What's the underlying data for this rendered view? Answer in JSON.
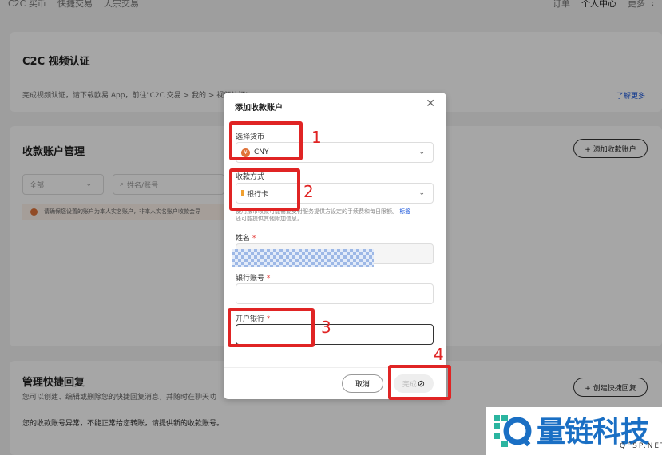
{
  "topnav": {
    "items": [
      "C2C 买币",
      "快捷交易",
      "大宗交易"
    ],
    "right": [
      "订单",
      "个人中心",
      "更多"
    ]
  },
  "video_section": {
    "title": "C2C 视频认证",
    "desc": "完成视频认证，请下载欧易 App，前往\"C2C 交易 > 我的 > 视频认证\"",
    "link": "了解更多"
  },
  "accounts_section": {
    "title": "收款账户管理",
    "add_button": "+ 添加收款账户",
    "filter_value": "全部",
    "search_placeholder": "姓名/账号",
    "notice": "请确保您设置的账户为本人实名账户，非本人实名账户收款会导"
  },
  "quick_reply_section": {
    "title": "管理快捷回复",
    "desc": "您可以创建、编辑或删除您的快捷回复消息，并随时在聊天功",
    "create_button": "+ 创建快捷回复",
    "warning": "您的收款账号异常，不能正常给您转账，请提供新的收款账号。"
  },
  "modal": {
    "title": "添加收款账户",
    "currency_label": "选择货币",
    "currency_value": "CNY",
    "currency_symbol": "¥",
    "method_label": "收款方式",
    "method_value": "银行卡",
    "hint_text": "使用法币收款可能需要支付服务提供方设定的手续费和每日限额。",
    "hint_link": "标签",
    "hint_text2": "还可能提供其他附加信息。",
    "name_label": "姓名",
    "account_label": "银行账号",
    "bank_label": "开户银行",
    "required_mark": "*",
    "cancel": "取消",
    "confirm": "完成"
  },
  "annotations": [
    "1",
    "2",
    "3",
    "4"
  ],
  "watermark": {
    "text": "量链科技",
    "sub": "QFSP.NET"
  },
  "colors": {
    "annotation_red": "#e02424",
    "link_blue": "#1a56db",
    "watermark_green": "#2bb5a0",
    "watermark_blue": "#1a6fc4"
  }
}
